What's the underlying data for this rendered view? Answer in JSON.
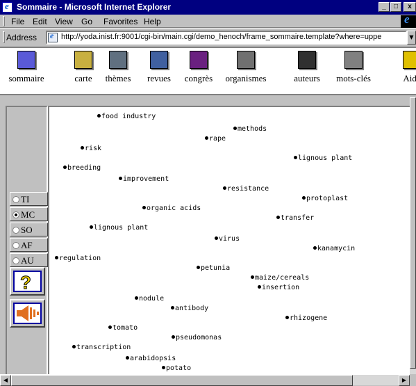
{
  "window": {
    "title": "Sommaire - Microsoft Internet Explorer",
    "controls": {
      "minimize": "_",
      "maximize": "□",
      "close": "x"
    }
  },
  "menu": [
    "File",
    "Edit",
    "View",
    "Go",
    "Favorites",
    "Help"
  ],
  "address": {
    "label": "Address",
    "url": "http://yoda.inist.fr:9001/cgi-bin/main.cgi/demo_henoch/frame_sommaire.template?where=uppe"
  },
  "nav": [
    {
      "label": "sommaire",
      "icon": "sommaire-icon",
      "color": "#5a5ad8"
    },
    {
      "label": "carte",
      "icon": "map-icon",
      "color": "#c8b040"
    },
    {
      "label": "thèmes",
      "icon": "themes-icon",
      "color": "#607080"
    },
    {
      "label": "revues",
      "icon": "journals-icon",
      "color": "#4060a0"
    },
    {
      "label": "congrès",
      "icon": "congress-icon",
      "color": "#6a2080"
    },
    {
      "label": "organismes",
      "icon": "organisms-icon",
      "color": "#707070"
    },
    {
      "label": "auteurs",
      "icon": "authors-icon",
      "color": "#303030"
    },
    {
      "label": "mots-clés",
      "icon": "keywords-icon",
      "color": "#808080"
    },
    {
      "label": "Aide",
      "icon": "help-icon",
      "color": "#e0c000"
    }
  ],
  "search_fields": [
    {
      "label": "TI",
      "selected": false
    },
    {
      "label": "MC",
      "selected": true
    },
    {
      "label": "SO",
      "selected": false
    },
    {
      "label": "AF",
      "selected": false
    },
    {
      "label": "AU",
      "selected": false
    }
  ],
  "keywords": [
    "food industry",
    "methods",
    "rape",
    "risk",
    "lignous plant",
    "breeding",
    "improvement",
    "resistance",
    "protoplast",
    "organic acids",
    "transfer",
    "lignous plant",
    "virus",
    "kanamycin",
    "regulation",
    "petunia",
    "maize/cereals",
    "insertion",
    "nodule",
    "antibody",
    "rhizogene",
    "tomato",
    "pseudomonas",
    "transcription",
    "arabidopsis",
    "potato"
  ]
}
